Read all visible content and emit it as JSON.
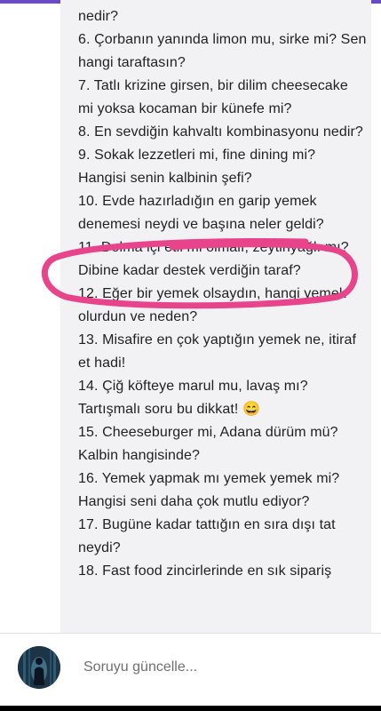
{
  "questions": [
    "nedir?",
    "6. Çorbanın yanında limon mu, sirke mi? Sen",
    "hangi taraftasın?",
    "7. Tatlı krizine girsen, bir dilim cheesecake",
    "mi yoksa kocaman bir künefe mi?",
    "8. En sevdiğin kahvaltı kombinasyonu nedir?",
    "9. Sokak lezzetleri mi, fine dining mi?",
    "Hangisi senin kalbinin şefi?",
    "10. Evde hazırladığın en garip yemek",
    "denemesi neydi ve başına neler geldi?",
    "11. Dolma içi etli mi olmalı, zeytinyağlı mı?",
    "Dibine kadar destek verdiğin taraf?",
    "12. Eğer bir yemek olsaydın, hangi yemek",
    "olurdun ve neden?",
    "13. Misafire en çok yaptığın yemek ne, itiraf",
    "et hadi!",
    "14. Çiğ köfteye marul mu, lavaş mı?",
    "Tartışmalı soru bu dikkat! 😄",
    "15. Cheeseburger mi, Adana dürüm mü?",
    "Kalbin hangisinde?",
    "16. Yemek yapmak mı yemek yemek mi?",
    "Hangisi seni daha çok mutlu ediyor?",
    "17. Bugüne kadar tattığın en sıra dışı tat",
    "neydi?",
    "18. Fast food zincirlerinde en sık sipariş"
  ],
  "composer": {
    "placeholder": "Soruyu güncelle..."
  },
  "colors": {
    "accent": "#6a4bc4",
    "highlight": "#e8448c",
    "panel": "#f2f2f4"
  }
}
